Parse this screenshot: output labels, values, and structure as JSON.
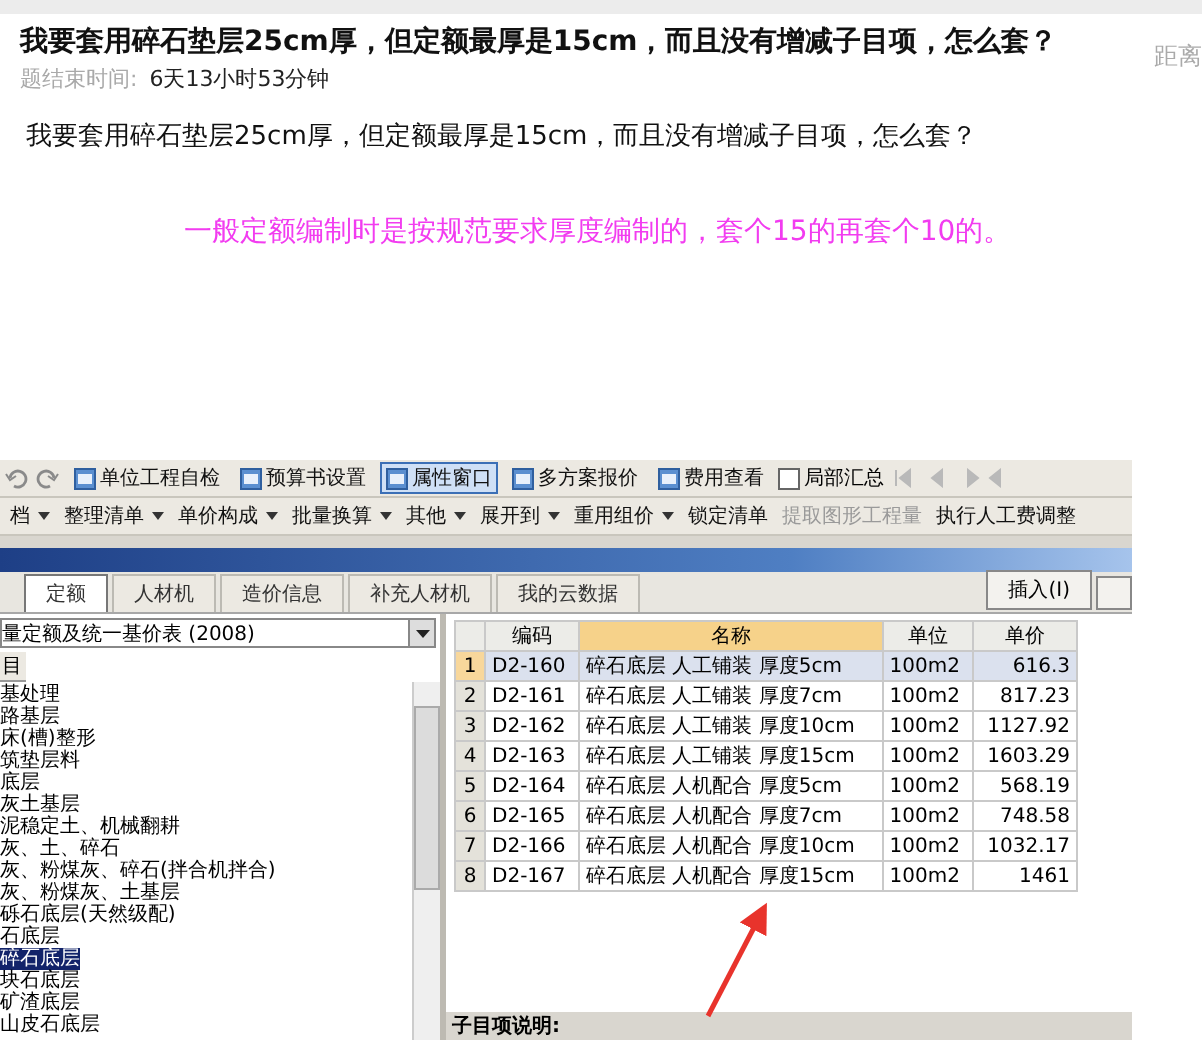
{
  "question": {
    "title": "我要套用碎石垫层25cm厚，但定额最厚是15cm，而且没有增减子目项，怎么套？",
    "meta_label": "题结束时间:",
    "meta_value": "6天13小时53分钟",
    "side_text": "距离"
  },
  "question_body": "我要套用碎石垫层25cm厚，但定额最厚是15cm，而且没有增减子目项，怎么套？",
  "answer": "一般定额编制时是按规范要求厚度编制的，套个15的再套个10的。",
  "app": {
    "toolbar_1": [
      {
        "kind": "button",
        "label": "单位工程自检",
        "selected": false
      },
      {
        "kind": "button",
        "label": "预算书设置",
        "selected": false
      },
      {
        "kind": "button",
        "label": "属性窗口",
        "selected": true
      },
      {
        "kind": "button",
        "label": "多方案报价",
        "selected": false
      },
      {
        "kind": "button",
        "label": "费用查看",
        "selected": false
      },
      {
        "kind": "checkbox",
        "label": "局部汇总",
        "checked": false
      }
    ],
    "toolbar_2": [
      {
        "label": "档",
        "dropdown": true,
        "disabled": false
      },
      {
        "label": "整理清单",
        "dropdown": true,
        "disabled": false
      },
      {
        "label": "单价构成",
        "dropdown": true,
        "disabled": false
      },
      {
        "label": "批量换算",
        "dropdown": true,
        "disabled": false
      },
      {
        "label": "其他",
        "dropdown": true,
        "disabled": false
      },
      {
        "label": "展开到",
        "dropdown": true,
        "disabled": false
      },
      {
        "label": "重用组价",
        "dropdown": true,
        "disabled": false
      },
      {
        "label": "锁定清单",
        "dropdown": false,
        "disabled": false
      },
      {
        "label": "提取图形工程量",
        "dropdown": false,
        "disabled": true
      },
      {
        "label": "执行人工费调整",
        "dropdown": false,
        "disabled": false
      }
    ],
    "tabs": [
      {
        "label": "定额",
        "selected": true
      },
      {
        "label": "人材机",
        "selected": false
      },
      {
        "label": "造价信息",
        "selected": false
      },
      {
        "label": "补充人材机",
        "selected": false
      },
      {
        "label": "我的云数据",
        "selected": false
      }
    ],
    "insert_button": "插入(I)",
    "library": "量定额及统一基价表 (2008)",
    "sub_tab": "目",
    "tree": [
      {
        "label": "基处理",
        "selected": false
      },
      {
        "label": "路基层",
        "selected": false
      },
      {
        "label": "床(槽)整形",
        "selected": false
      },
      {
        "label": "筑垫层料",
        "selected": false
      },
      {
        "label": "底层",
        "selected": false
      },
      {
        "label": "灰土基层",
        "selected": false
      },
      {
        "label": "泥稳定土、机械翻耕",
        "selected": false
      },
      {
        "label": "灰、土、碎石",
        "selected": false
      },
      {
        "label": "灰、粉煤灰、碎石(拌合机拌合)",
        "selected": false
      },
      {
        "label": "灰、粉煤灰、土基层",
        "selected": false
      },
      {
        "label": "砾石底层(天然级配)",
        "selected": false
      },
      {
        "label": "石底层",
        "selected": false
      },
      {
        "label": "碎石底层",
        "selected": true
      },
      {
        "label": "块石底层",
        "selected": false
      },
      {
        "label": "矿渣底层",
        "selected": false
      },
      {
        "label": "山皮石底层",
        "selected": false
      }
    ],
    "table": {
      "columns": [
        "编码",
        "名称",
        "单位",
        "单价"
      ],
      "rows": [
        {
          "index": "1",
          "code": "D2-160",
          "name": "碎石底层 人工铺装 厚度5cm",
          "unit": "100m2",
          "price": "616.3",
          "selected": true
        },
        {
          "index": "2",
          "code": "D2-161",
          "name": "碎石底层 人工铺装 厚度7cm",
          "unit": "100m2",
          "price": "817.23",
          "selected": false
        },
        {
          "index": "3",
          "code": "D2-162",
          "name": "碎石底层 人工铺装 厚度10cm",
          "unit": "100m2",
          "price": "1127.92",
          "selected": false
        },
        {
          "index": "4",
          "code": "D2-163",
          "name": "碎石底层 人工铺装 厚度15cm",
          "unit": "100m2",
          "price": "1603.29",
          "selected": false
        },
        {
          "index": "5",
          "code": "D2-164",
          "name": "碎石底层 人机配合 厚度5cm",
          "unit": "100m2",
          "price": "568.19",
          "selected": false
        },
        {
          "index": "6",
          "code": "D2-165",
          "name": "碎石底层 人机配合 厚度7cm",
          "unit": "100m2",
          "price": "748.58",
          "selected": false
        },
        {
          "index": "7",
          "code": "D2-166",
          "name": "碎石底层 人机配合 厚度10cm",
          "unit": "100m2",
          "price": "1032.17",
          "selected": false
        },
        {
          "index": "8",
          "code": "D2-167",
          "name": "碎石底层 人机配合 厚度15cm",
          "unit": "100m2",
          "price": "1461",
          "selected": false
        }
      ]
    },
    "footer_label": "子目项说明:"
  }
}
